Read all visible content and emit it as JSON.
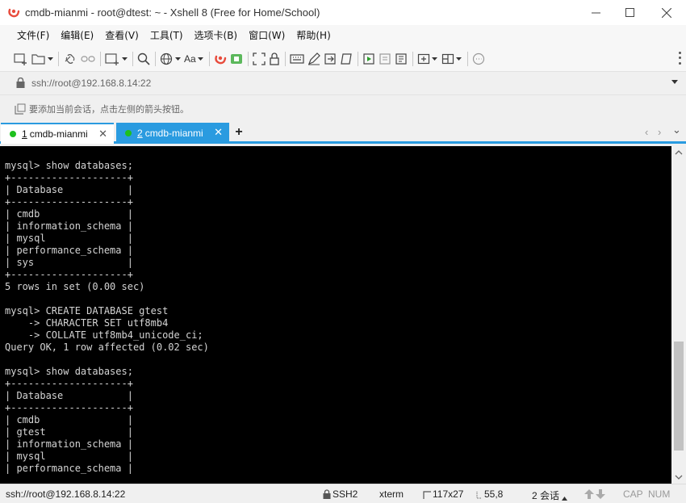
{
  "window": {
    "title": "cmdb-mianmi - root@dtest: ~ - Xshell 8 (Free for Home/School)"
  },
  "menu": {
    "items": [
      "文件(F)",
      "编辑(E)",
      "查看(V)",
      "工具(T)",
      "选项卡(B)",
      "窗口(W)",
      "帮助(H)"
    ]
  },
  "toolbar": {
    "font_label": "Aa"
  },
  "address": {
    "value": "ssh://root@192.168.8.14:22"
  },
  "hint": {
    "text": "要添加当前会话，点击左侧的箭头按钮。"
  },
  "tabs": [
    {
      "number": "1",
      "label": "cmdb-mianmi",
      "active": false
    },
    {
      "number": "2",
      "label": "cmdb-mianmi",
      "active": true
    }
  ],
  "tab_nav": {
    "prev": "‹",
    "next": "›",
    "menu": "⌄"
  },
  "terminal": {
    "lines": [
      "mysql> show databases;",
      "+--------------------+",
      "| Database           |",
      "+--------------------+",
      "| cmdb               |",
      "| information_schema |",
      "| mysql              |",
      "| performance_schema |",
      "| sys                |",
      "+--------------------+",
      "5 rows in set (0.00 sec)",
      "",
      "mysql> CREATE DATABASE gtest",
      "    -> CHARACTER SET utf8mb4",
      "    -> COLLATE utf8mb4_unicode_ci;",
      "Query OK, 1 row affected (0.02 sec)",
      "",
      "mysql> show databases;",
      "+--------------------+",
      "| Database           |",
      "+--------------------+",
      "| cmdb               |",
      "| gtest              |",
      "| information_schema |",
      "| mysql              |",
      "| performance_schema |"
    ]
  },
  "status": {
    "connection": "ssh://root@192.168.8.14:22",
    "protocol": "SSH2",
    "terminal_type": "xterm",
    "size": "117x27",
    "cursor": "55,8",
    "sessions": "2 会话",
    "caps": "CAP",
    "num": "NUM"
  },
  "colors": {
    "accent": "#2a9be0",
    "status_dot": "#1ec01e",
    "terminal_bg": "#000000",
    "terminal_fg": "#d4d4d4"
  }
}
